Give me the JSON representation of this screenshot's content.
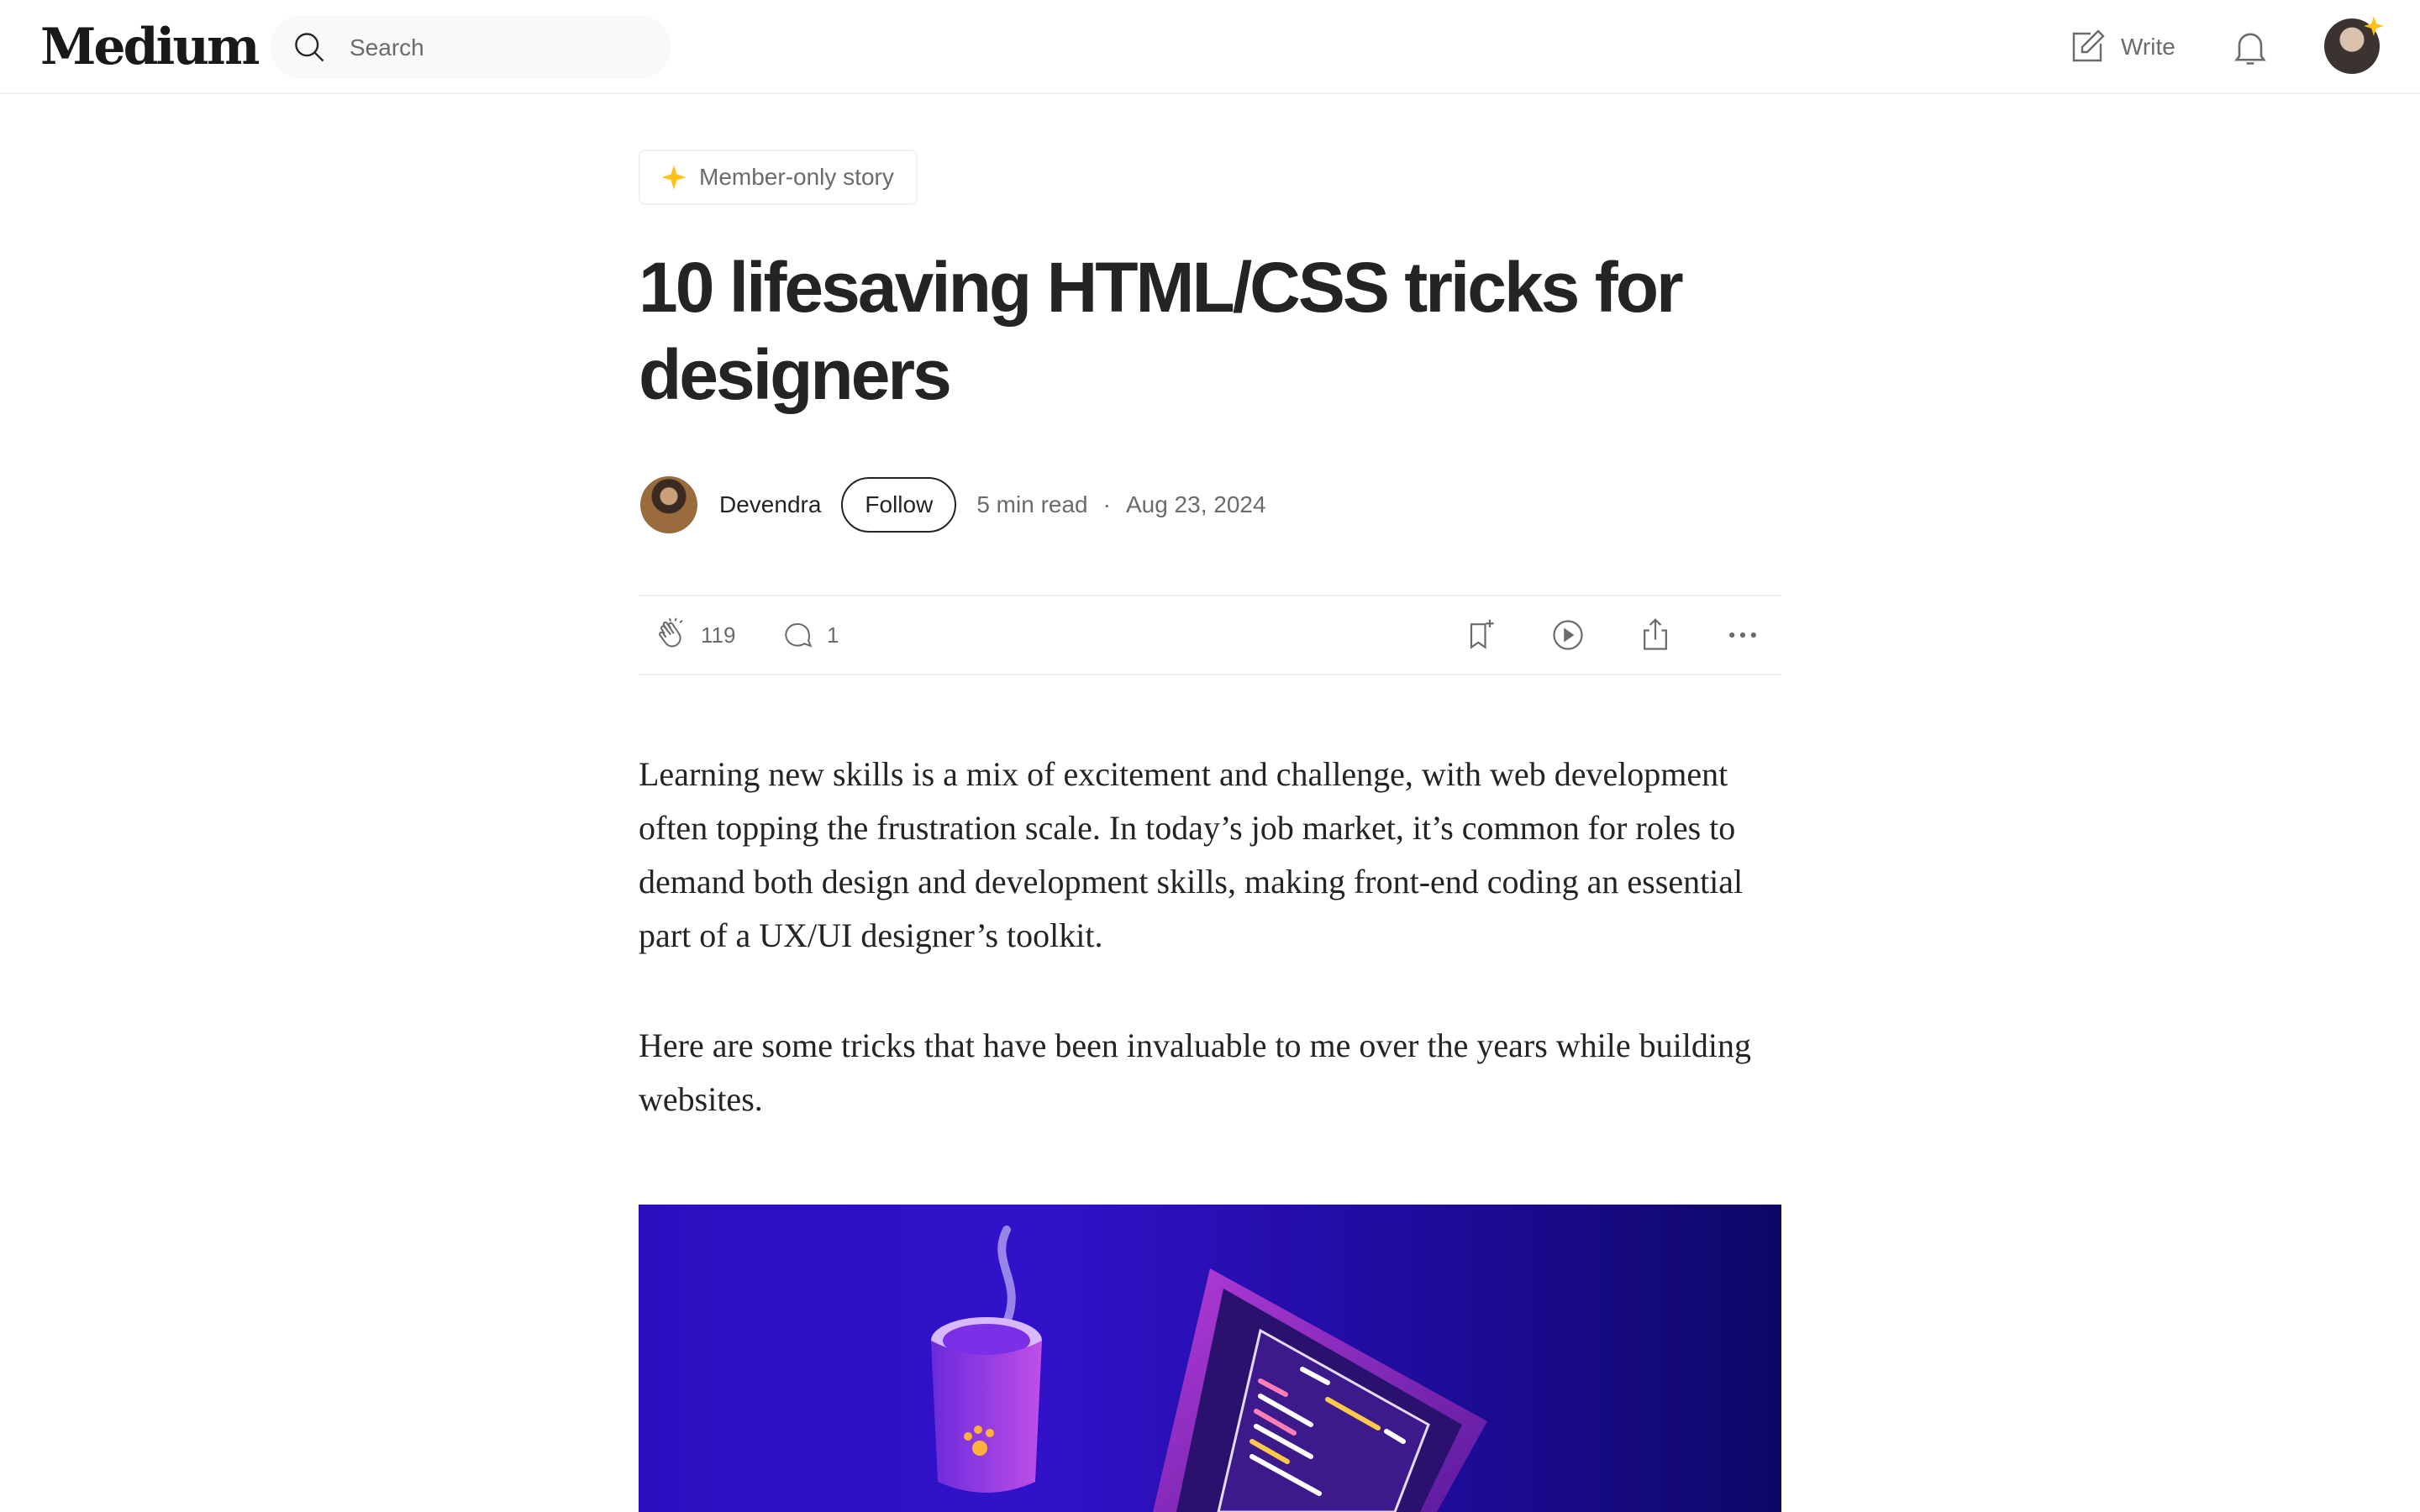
{
  "header": {
    "logo": "Medium",
    "search_placeholder": "Search",
    "write_label": "Write"
  },
  "article": {
    "badge": "Member-only story",
    "title": "10 lifesaving HTML/CSS tricks for designers",
    "author": "Devendra",
    "follow_label": "Follow",
    "read_time": "5 min read",
    "separator": "·",
    "date": "Aug 23, 2024",
    "claps": "119",
    "responses": "1",
    "paragraphs": [
      "Learning new skills is a mix of excitement and challenge, with web development often topping the frustration scale. In today’s job market, it’s common for roles to demand both design and development skills, making front-end coding an essential part of a UX/UI designer’s toolkit.",
      "Here are some tricks that have been invaluable to me over the years while building websites."
    ]
  },
  "colors": {
    "accent_star": "#ffc017",
    "text": "#242424",
    "muted": "#6b6b6b"
  },
  "icons": [
    "search-icon",
    "write-icon",
    "bell-icon",
    "star-icon",
    "clap-icon",
    "comment-icon",
    "bookmark-icon",
    "play-icon",
    "share-icon",
    "more-icon"
  ]
}
